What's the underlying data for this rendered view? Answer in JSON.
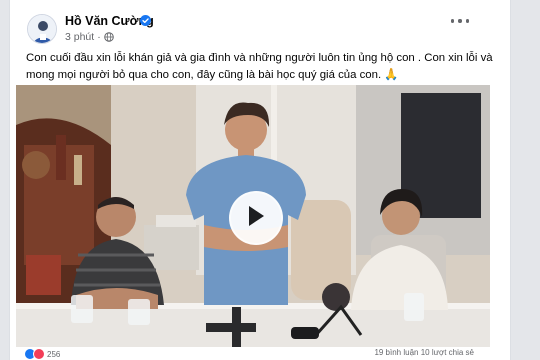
{
  "post": {
    "author_name": "Hồ Văn Cường",
    "timestamp": "3 phút",
    "caption": "Con cuối đầu xin lỗi khán giả và gia đình và những người luôn tin ủng hộ con . Con xin lỗi và mong mọi người bỏ qua cho con, đây cũng là bài học quý giá của con. 🙏",
    "reaction_count": "256",
    "engagement_stats": "19 bình luận   10 lượt chia sẻ"
  },
  "icons": {
    "verified": "verified-badge-icon",
    "privacy": "globe-icon",
    "more": "more-options-icon",
    "play": "play-icon",
    "like": "like-reaction-icon",
    "love": "love-reaction-icon"
  },
  "colors": {
    "verified_blue": "#1877f2",
    "like_blue": "#1877f2",
    "love_red": "#f33e58",
    "text_secondary": "#65676b"
  }
}
